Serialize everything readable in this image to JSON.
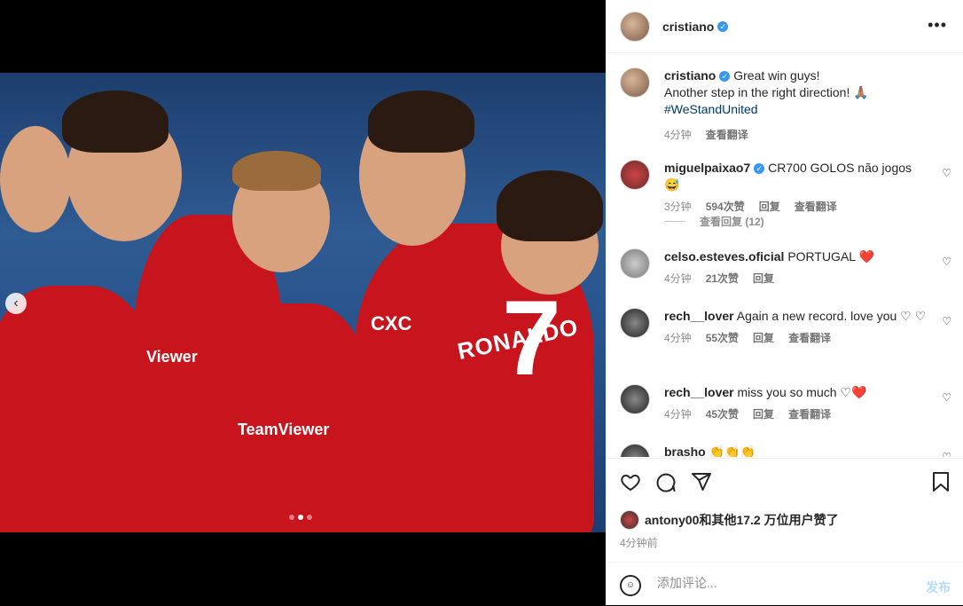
{
  "post": {
    "author": "cristiano",
    "more_icon": "more-horizontal-icon"
  },
  "media": {
    "prev_icon": "‹",
    "shirt_name": "RONALDO",
    "shirt_number": "7",
    "sponsors": [
      "Viewer",
      "TeamViewer",
      "CXC"
    ],
    "slide_count": 3,
    "active_slide": 1
  },
  "caption": {
    "username": "cristiano",
    "line1": "Great win guys!",
    "line2": "Another step in the right direction! 🙏🏽",
    "hashtag": "#WeStandUnited",
    "time": "4分钟",
    "translate": "查看翻译"
  },
  "comments": [
    {
      "username": "miguelpaixao7",
      "verified": true,
      "text": "CR700 GOLOS não jogos 😅",
      "time": "3分钟",
      "likes": "594次赞",
      "reply": "回复",
      "translate": "查看翻译"
    },
    {
      "username": "celso.esteves.oficial",
      "verified": false,
      "text": "PORTUGAL ❤️",
      "time": "4分钟",
      "likes": "21次赞",
      "reply": "回复",
      "translate": ""
    },
    {
      "username": "rech__lover",
      "verified": false,
      "text": "Again a new record. love you ♡ ♡",
      "time": "4分钟",
      "likes": "55次赞",
      "reply": "回复",
      "translate": "查看翻译"
    },
    {
      "username": "rech__lover",
      "verified": false,
      "text": "miss you so much ♡❤️",
      "time": "4分钟",
      "likes": "45次赞",
      "reply": "回复",
      "translate": "查看翻译"
    },
    {
      "username": "brasho",
      "verified": false,
      "text": "👏👏👏",
      "time": "",
      "likes": "",
      "reply": "",
      "translate": ""
    }
  ],
  "view_replies": "查看回复 (12)",
  "likes_summary": {
    "user": "antony00",
    "text": "和其他17.2 万位用户赞了"
  },
  "time_ago": "4分钟前",
  "comment_input": {
    "placeholder": "添加评论...",
    "post_label": "发布"
  }
}
